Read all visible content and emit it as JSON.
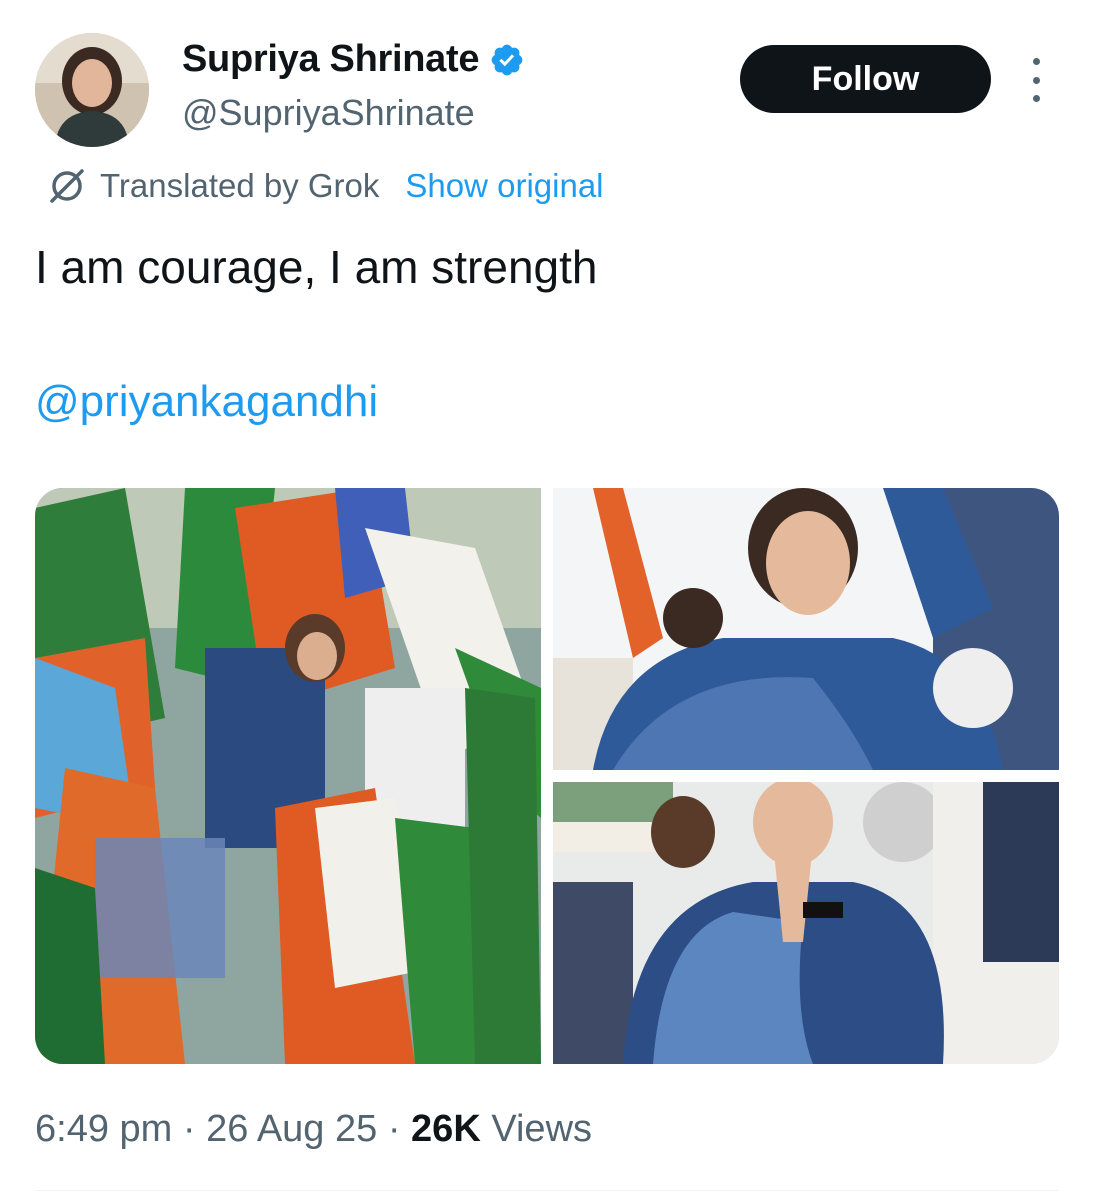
{
  "author": {
    "display_name": "Supriya Shrinate",
    "handle": "@SupriyaShrinate",
    "verified": true
  },
  "header": {
    "follow_label": "Follow"
  },
  "translation": {
    "label": "Translated by Grok",
    "show_original_label": "Show original"
  },
  "tweet": {
    "text": "I am courage, I am strength",
    "mention": "@priyankagandhi"
  },
  "media": {
    "photos": [
      {
        "description": "rally crowd with flags"
      },
      {
        "description": "woman in blue waving"
      },
      {
        "description": "woman in blue with folded hands"
      }
    ]
  },
  "meta": {
    "time": "6:49 pm",
    "separator": "·",
    "date": "26 Aug 25",
    "views_count": "26K",
    "views_label": "Views"
  },
  "colors": {
    "text_primary": "#0f1419",
    "text_secondary": "#536471",
    "link": "#1d9bf0",
    "button_bg": "#0f1419",
    "verified_badge": "#1d9bf0"
  },
  "icons": {
    "verified": "verified-badge-icon",
    "more": "more-options-icon",
    "translate": "grok-icon"
  }
}
